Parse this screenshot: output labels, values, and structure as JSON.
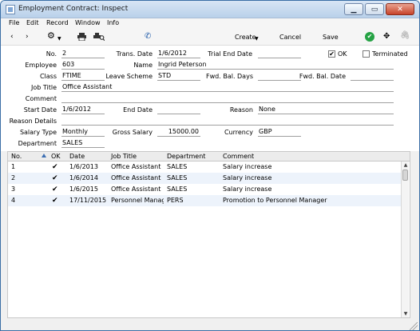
{
  "window": {
    "title": "Employment Contract: Inspect"
  },
  "menu": [
    "File",
    "Edit",
    "Record",
    "Window",
    "Info"
  ],
  "toolbar": {
    "create": "Create",
    "cancel": "Cancel",
    "save": "Save"
  },
  "icons": [
    "back-arrow-icon",
    "forward-arrow-icon",
    "gear-icon",
    "printer-icon",
    "print-preview-icon",
    "phone-icon",
    "green-check-circle-icon",
    "expand-icon",
    "paperclip-icon"
  ],
  "form": {
    "no": {
      "label": "No.",
      "value": "2"
    },
    "trans_date": {
      "label": "Trans. Date",
      "value": "1/6/2012"
    },
    "trial_end_date": {
      "label": "Trial End Date",
      "value": ""
    },
    "ok": {
      "label": "OK",
      "checked": true
    },
    "terminated": {
      "label": "Terminated",
      "checked": false
    },
    "employee": {
      "label": "Employee",
      "value": "603"
    },
    "name": {
      "label": "Name",
      "value": "Ingrid Peterson"
    },
    "class": {
      "label": "Class",
      "value": "FTIME"
    },
    "leave_scheme": {
      "label": "Leave Scheme",
      "value": "STD"
    },
    "fwd_bal_days": {
      "label": "Fwd. Bal. Days",
      "value": ""
    },
    "fwd_bal_date": {
      "label": "Fwd. Bal. Date",
      "value": ""
    },
    "job_title": {
      "label": "Job Title",
      "value": "Office Assistant"
    },
    "comment": {
      "label": "Comment",
      "value": ""
    },
    "start_date": {
      "label": "Start Date",
      "value": "1/6/2012"
    },
    "end_date": {
      "label": "End Date",
      "value": ""
    },
    "reason": {
      "label": "Reason",
      "value": "None"
    },
    "reason_details": {
      "label": "Reason Details",
      "value": ""
    },
    "salary_type": {
      "label": "Salary Type",
      "value": "Monthly"
    },
    "gross_salary": {
      "label": "Gross Salary",
      "value": "15000.00"
    },
    "currency": {
      "label": "Currency",
      "value": "GBP"
    },
    "department": {
      "label": "Department",
      "value": "SALES"
    }
  },
  "grid": {
    "headers": {
      "no": "No.",
      "ok": "OK",
      "date": "Date",
      "job_title": "Job Title",
      "department": "Department",
      "comment": "Comment"
    },
    "rows": [
      {
        "no": "1",
        "ok": "✔",
        "date": "1/6/2013",
        "job_title": "Office Assistant",
        "department": "SALES",
        "comment": "Salary increase"
      },
      {
        "no": "2",
        "ok": "✔",
        "date": "1/6/2014",
        "job_title": "Office Assistant",
        "department": "SALES",
        "comment": "Salary increase"
      },
      {
        "no": "3",
        "ok": "✔",
        "date": "1/6/2015",
        "job_title": "Office Assistant",
        "department": "SALES",
        "comment": "Salary increase"
      },
      {
        "no": "4",
        "ok": "✔",
        "date": "17/11/2015",
        "job_title": "Personnel Manag…",
        "department": "PERS",
        "comment": "Promotion to Personnel Manager"
      }
    ]
  }
}
